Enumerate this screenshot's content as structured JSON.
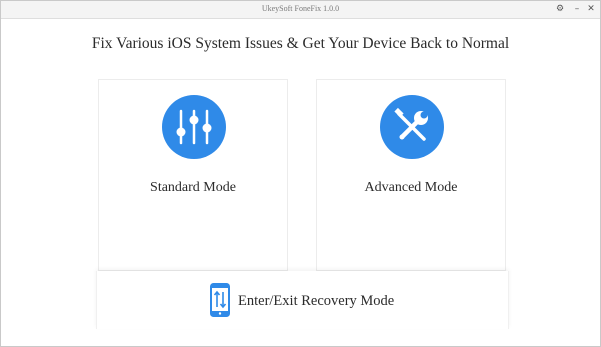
{
  "window": {
    "title": "UkeySoft FoneFix 1.0.0",
    "controls": {
      "settings": "⚙",
      "minimize": "–",
      "close": "✕"
    }
  },
  "main": {
    "headline": "Fix Various iOS System Issues & Get Your Device Back to Normal",
    "modes": [
      {
        "label": "Standard Mode",
        "icon": "sliders-icon"
      },
      {
        "label": "Advanced Mode",
        "icon": "tools-icon"
      }
    ],
    "recovery": {
      "label": "Enter/Exit Recovery Mode",
      "icon": "phone-arrows-icon"
    }
  },
  "colors": {
    "accent": "#2f8ae8",
    "text": "#2b2b2b"
  }
}
